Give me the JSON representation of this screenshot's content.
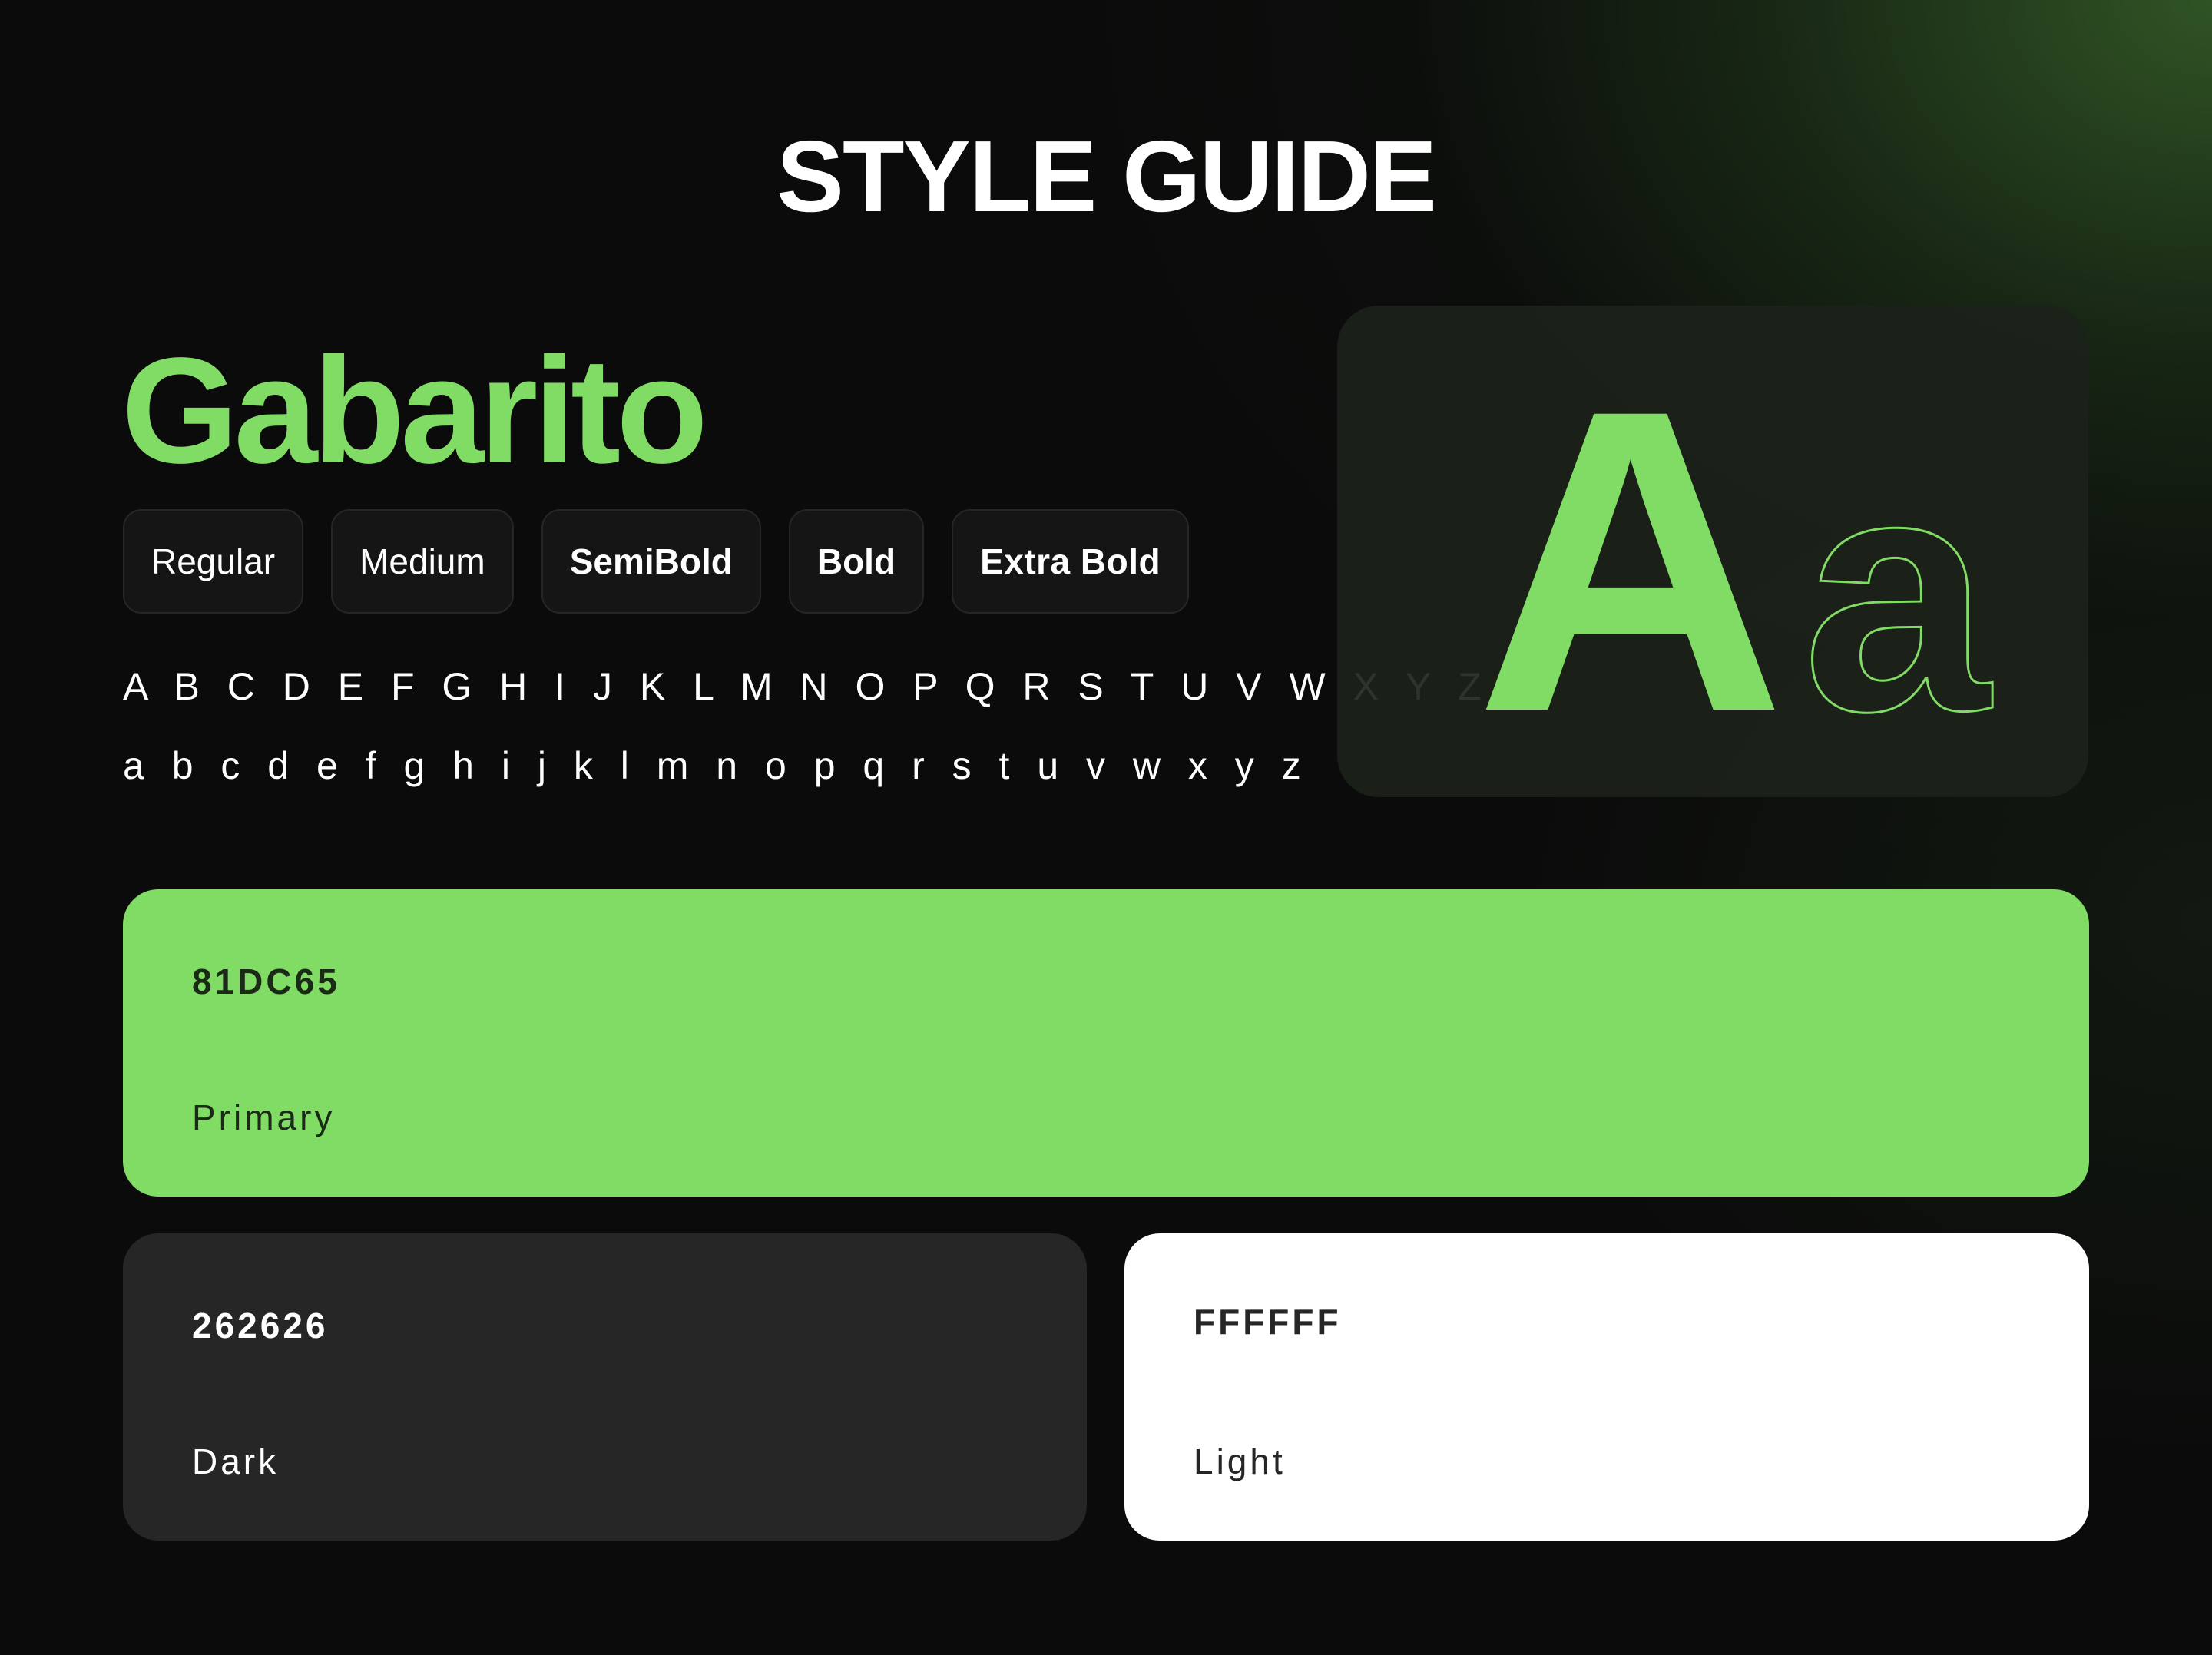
{
  "header": {
    "title": "STYLE GUIDE"
  },
  "typography": {
    "font_name": "Gabarito",
    "weights": [
      "Regular",
      "Medium",
      "SemiBold",
      "Bold",
      "Extra Bold"
    ],
    "uppercase": "A B C D E F G H I J K L M N O P Q R S T U V W X Y Z",
    "lowercase": "a b c d e f g h i j k l m n o p q r s t u v w x y z",
    "specimen": {
      "upper_glyph": "A",
      "lower_glyph": "a"
    }
  },
  "palette": {
    "primary": {
      "code": "81DC65",
      "label": "Primary",
      "color": "#81DC65"
    },
    "dark": {
      "code": "262626",
      "label": "Dark",
      "color": "#262626"
    },
    "light": {
      "code": "FFFFFF",
      "label": "Light",
      "color": "#FFFFFF"
    }
  },
  "colors": {
    "background": "#0b0b0b",
    "accent": "#81DC65",
    "chip_border": "#262626"
  }
}
